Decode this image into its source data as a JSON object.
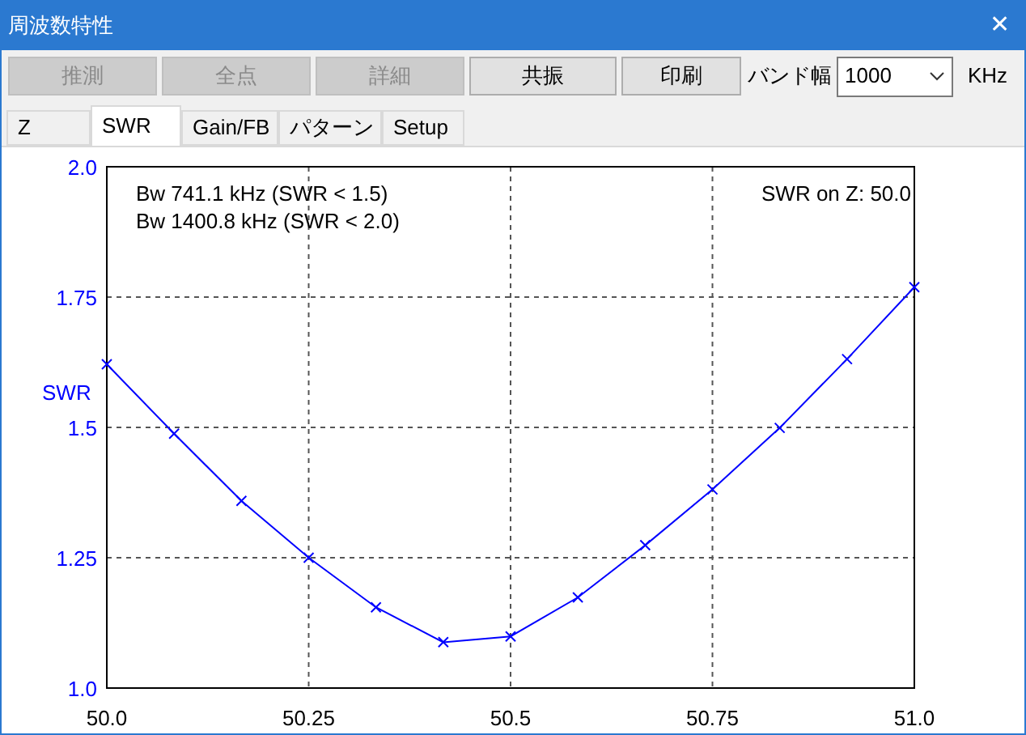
{
  "window": {
    "title": "周波数特性",
    "close": "✕"
  },
  "toolbar": {
    "buttons": [
      {
        "label": "推測",
        "disabled": true
      },
      {
        "label": "全点",
        "disabled": true
      },
      {
        "label": "詳細",
        "disabled": true
      },
      {
        "label": "共振",
        "disabled": false
      },
      {
        "label": "印刷",
        "disabled": false
      }
    ],
    "band_label": "バンド幅",
    "band_value": "1000",
    "unit": "KHz"
  },
  "tabs": [
    {
      "label": "Z",
      "selected": false
    },
    {
      "label": "SWR",
      "selected": true
    },
    {
      "label": "Gain/FB",
      "selected": false
    },
    {
      "label": "パターン",
      "selected": false
    },
    {
      "label": "Setup",
      "selected": false
    }
  ],
  "chart_data": {
    "type": "line",
    "ylabel": "SWR",
    "x": [
      50.0,
      50.0833,
      50.1667,
      50.25,
      50.3333,
      50.4167,
      50.5,
      50.5833,
      50.6667,
      50.75,
      50.8333,
      50.9167,
      51.0
    ],
    "grid": true,
    "series": [
      {
        "color": "#0000ff",
        "marker": "x",
        "values": [
          1.621,
          1.488,
          1.359,
          1.25,
          1.155,
          1.088,
          1.099,
          1.174,
          1.274,
          1.381,
          1.499,
          1.631,
          1.769
        ]
      }
    ],
    "xlim": [
      50.0,
      51.0
    ],
    "ylim": [
      1.0,
      2.0
    ],
    "xticks": [
      {
        "value": 50.0,
        "label": "50.0"
      },
      {
        "value": 50.25,
        "label": "50.25"
      },
      {
        "value": 50.5,
        "label": "50.5"
      },
      {
        "value": 50.75,
        "label": "50.75"
      },
      {
        "value": 51.0,
        "label": "51.0"
      }
    ],
    "yticks": [
      {
        "value": 1.0,
        "label": "1.0"
      },
      {
        "value": 1.25,
        "label": "1.25"
      },
      {
        "value": 1.5,
        "label": "1.5"
      },
      {
        "value": 1.75,
        "label": "1.75"
      },
      {
        "value": 2.0,
        "label": "2.0"
      }
    ],
    "annotations": [
      {
        "text": "Bw 741.1 kHz (SWR < 1.5)"
      },
      {
        "text": "Bw 1400.8 kHz (SWR < 2.0)"
      }
    ]
  },
  "impedance_note": "SWR on Z: 50.0"
}
